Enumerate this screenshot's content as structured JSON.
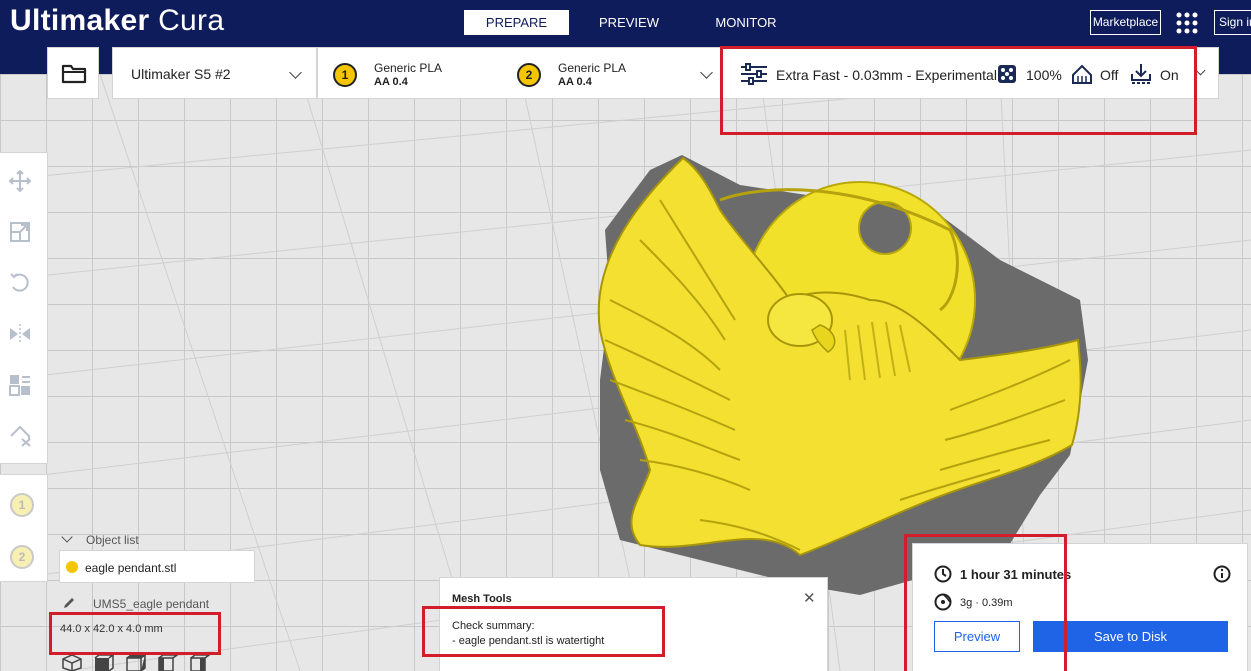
{
  "app": {
    "name_bold": "Ultimaker",
    "name_light": "Cura"
  },
  "nav": {
    "tabs": [
      {
        "label": "PREPARE",
        "active": true
      },
      {
        "label": "PREVIEW",
        "active": false
      },
      {
        "label": "MONITOR",
        "active": false
      }
    ]
  },
  "header": {
    "marketplace_label": "Marketplace",
    "signin_label": "Sign in"
  },
  "printer": {
    "name": "Ultimaker S5 #2"
  },
  "extruders": [
    {
      "number": "1",
      "material": "Generic PLA",
      "nozzle": "AA 0.4"
    },
    {
      "number": "2",
      "material": "Generic PLA",
      "nozzle": "AA 0.4"
    }
  ],
  "print_settings": {
    "profile": "Extra Fast - 0.03mm - Experimental",
    "infill": "100%",
    "support": "Off",
    "adhesion": "On"
  },
  "object_list": {
    "title": "Object list",
    "objects": [
      {
        "name": "eagle pendant.stl"
      }
    ],
    "job_name": "UMS5_eagle pendant",
    "dimensions": "44.0 x 42.0 x 4.0 mm"
  },
  "mesh_tools": {
    "title": "Mesh Tools",
    "line1": "Check summary:",
    "line2": "- eagle pendant.stl is watertight"
  },
  "summary": {
    "time": "1 hour 31 minutes",
    "material": "3g · 0.39m",
    "preview_label": "Preview",
    "save_label": "Save to Disk"
  },
  "colors": {
    "header": "#0f1c5c",
    "accent": "#1f63e6",
    "model": "#f3e030",
    "annotation": "#d21e2b"
  },
  "icons": [
    "folder-icon",
    "move-icon",
    "scale-icon",
    "rotate-icon",
    "mirror-icon",
    "per-model-settings-icon",
    "support-blocker-icon",
    "settings-sliders-icon",
    "infill-icon",
    "support-icon",
    "adhesion-icon",
    "clock-icon",
    "spool-icon",
    "info-icon",
    "apps-grid-icon",
    "pencil-icon",
    "view-cube-icon"
  ]
}
